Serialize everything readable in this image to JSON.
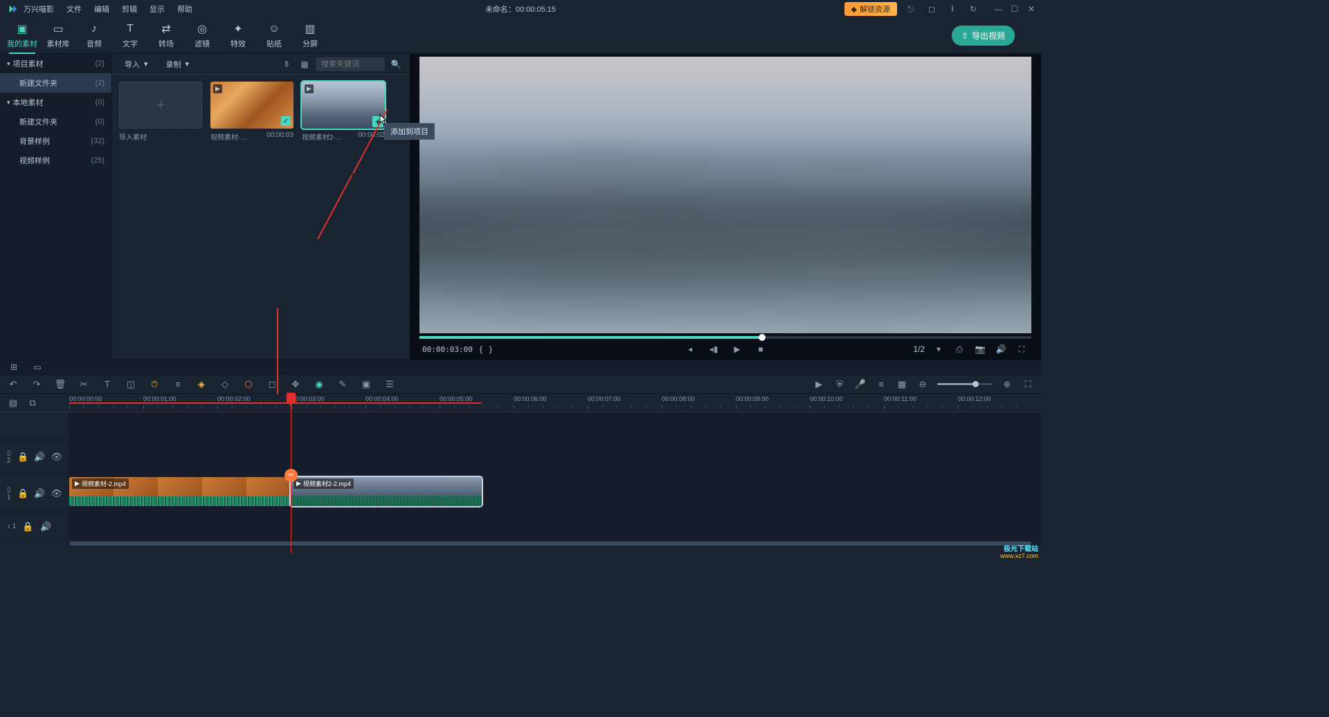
{
  "app": {
    "name": "万兴喵影"
  },
  "menus": [
    "文件",
    "编辑",
    "剪辑",
    "显示",
    "帮助"
  ],
  "title": "未命名：00:00:05:15",
  "unlock": "解锁资源",
  "main_tabs": [
    {
      "label": "我的素材",
      "icon": "▢"
    },
    {
      "label": "素材库",
      "icon": "▭"
    },
    {
      "label": "音频",
      "icon": "♪"
    },
    {
      "label": "文字",
      "icon": "T"
    },
    {
      "label": "转场",
      "icon": "⇄"
    },
    {
      "label": "滤镜",
      "icon": "◎"
    },
    {
      "label": "特效",
      "icon": "✦"
    },
    {
      "label": "贴纸",
      "icon": "☺"
    },
    {
      "label": "分屏",
      "icon": "▥"
    }
  ],
  "export_label": "导出视频",
  "sidebar": [
    {
      "label": "项目素材",
      "count": "(2)",
      "exp": true
    },
    {
      "label": "新建文件夹",
      "count": "(2)",
      "child": true,
      "selected": true
    },
    {
      "label": "本地素材",
      "count": "(0)",
      "exp": true
    },
    {
      "label": "新建文件夹",
      "count": "(0)",
      "child": true
    },
    {
      "label": "背景样例",
      "count": "(32)"
    },
    {
      "label": "视频样例",
      "count": "(25)"
    }
  ],
  "media_toolbar": {
    "import": "导入",
    "record": "录制"
  },
  "search_placeholder": "搜索关键词",
  "media": [
    {
      "kind": "import",
      "label": "导入素材",
      "dur": ""
    },
    {
      "kind": "clip",
      "label": "视频素材-…",
      "dur": "00:00:03",
      "checked": true
    },
    {
      "kind": "clip",
      "label": "视频素材2-…",
      "dur": "00:00:02",
      "selected": true,
      "add": true
    }
  ],
  "tooltip": "添加到项目",
  "preview": {
    "time": "00:00:03:00",
    "brace_l": "{",
    "brace_r": "}",
    "ratio": "1/2"
  },
  "ruler_ticks": [
    "00:00:00:00",
    "00:00:01:00",
    "00:00:02:00",
    "00:00:03:00",
    "00:00:04:00",
    "00:00:05:00",
    "00:00:06:00",
    "00:00:07:00",
    "00:00:08:00",
    "00:00:09:00",
    "00:00:10:00",
    "00:00:11:00",
    "00:00:12:00"
  ],
  "tracks": {
    "video2": {
      "id": "▯ 2"
    },
    "video1": {
      "id": "▯ 1"
    },
    "audio1": {
      "id": "♪ 1"
    }
  },
  "clips": [
    {
      "name": "视频素材-2.mp4"
    },
    {
      "name": "视频素材2-2.mp4"
    }
  ],
  "watermark": {
    "l1": "极光下载站",
    "l2": "www.xz7.com"
  }
}
